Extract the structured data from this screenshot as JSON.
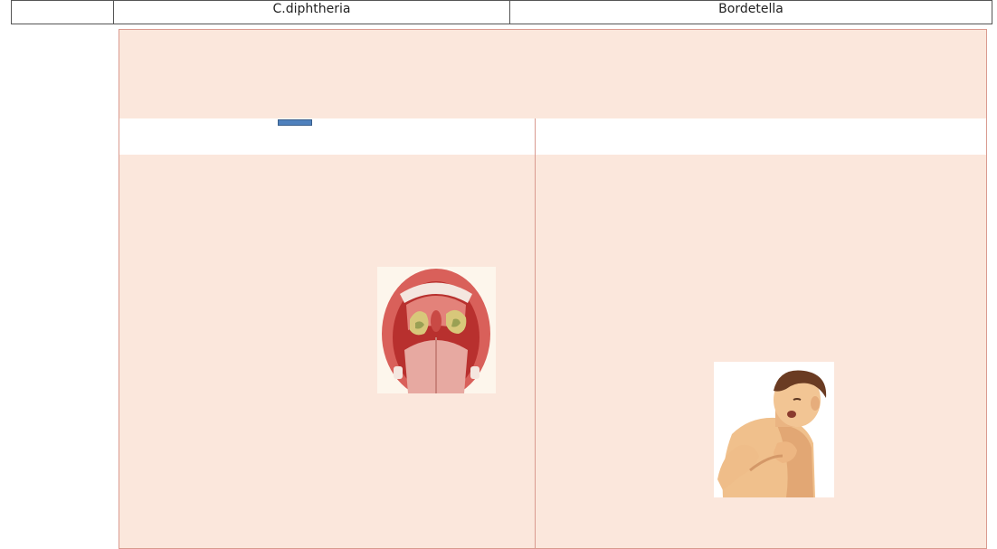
{
  "header": {
    "columns": [
      "",
      "C.diphtheria",
      "Bordetella"
    ]
  },
  "images": {
    "throat": "open-mouth-pseudomembrane-illustration",
    "boy": "coughing-child-illustration"
  },
  "colors": {
    "peach_fill": "#fbe7dc",
    "cell_border": "#d99a8f",
    "marker_blue": "#4f81bd"
  }
}
